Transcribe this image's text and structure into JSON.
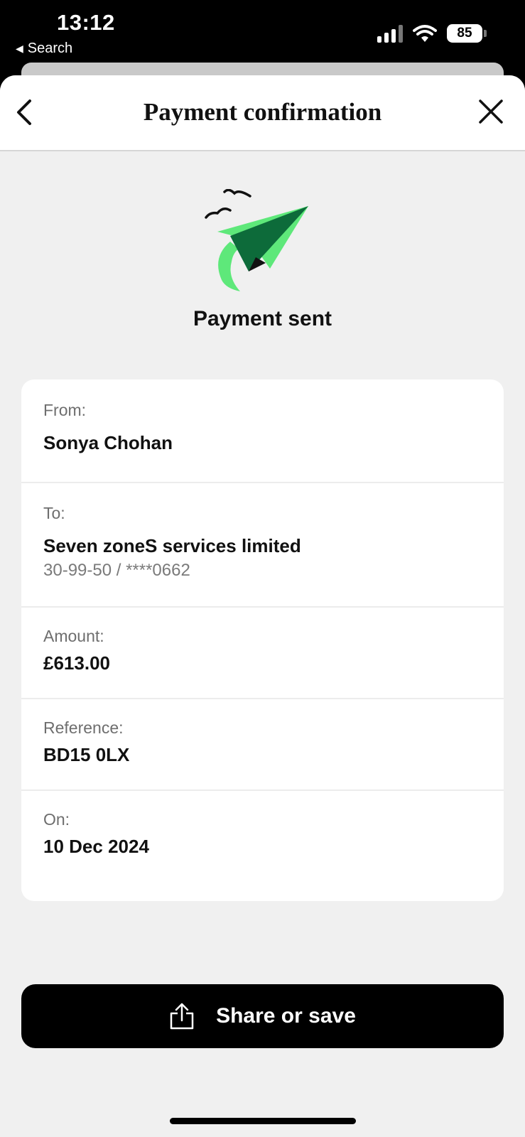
{
  "status_bar": {
    "time": "13:12",
    "back_app": "Search",
    "battery": "85",
    "icons": [
      "cellular-signal-icon",
      "wifi-icon",
      "battery-icon"
    ]
  },
  "header": {
    "title": "Payment confirmation",
    "icons": [
      "chevron-left-icon",
      "close-icon"
    ]
  },
  "status": {
    "title": "Payment sent",
    "illustration": "paper-plane-with-birds",
    "colors": {
      "plane_light": "#5ee87a",
      "plane_dark": "#0d6b3a"
    }
  },
  "details": {
    "from_label": "From:",
    "from_value": "Sonya Chohan",
    "to_label": "To:",
    "to_value": "Seven zoneS services limited",
    "to_account": "30-99-50 / ****0662",
    "amount_label": "Amount:",
    "amount_value": "£613.00",
    "reference_label": "Reference:",
    "reference_value": "BD15 0LX",
    "date_label": "On:",
    "date_value": "10 Dec 2024"
  },
  "actions": {
    "share_label": "Share or save",
    "share_icon": "share-icon"
  }
}
